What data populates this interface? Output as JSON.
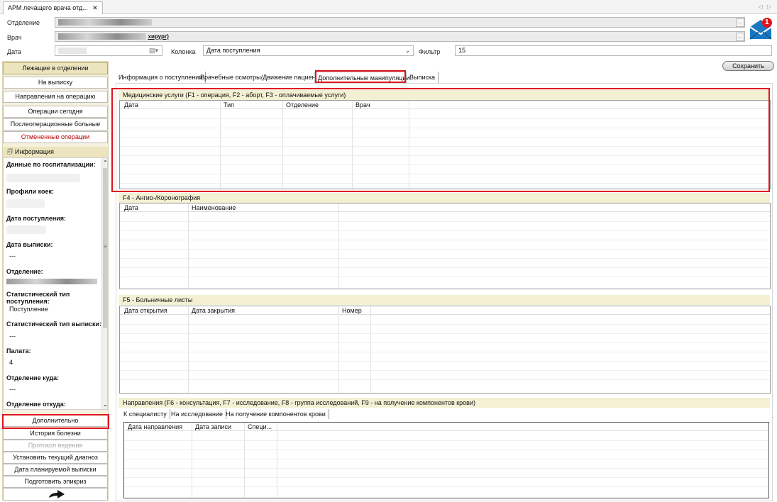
{
  "window": {
    "tab_title": "АРМ лечащего врача отд...",
    "close_glyph": "✕",
    "nav_arrows": "◁ ▷"
  },
  "header": {
    "department_label": "Отделение",
    "doctor_label": "Врач",
    "doctor_value_visible": "хирург)",
    "date_label": "Дата",
    "column_label": "Колонка",
    "column_value": "Дата поступления",
    "filter_label": "Фильтр",
    "filter_value": "15",
    "mail_badge_count": "1"
  },
  "sidebar": {
    "buttons": [
      {
        "label": "Лежащие в отделении",
        "state": "active"
      },
      {
        "label": "На выписку",
        "state": "normal"
      },
      {
        "label": "Направления на операцию",
        "state": "normal"
      },
      {
        "label": "Операции сегодня",
        "state": "normal"
      },
      {
        "label": "Послеоперационные больные",
        "state": "normal"
      },
      {
        "label": "Отмененные операции",
        "state": "red"
      }
    ],
    "info_header": "Информация",
    "info_fields": [
      {
        "title": "Данные по госпитализации:",
        "value": ""
      },
      {
        "title": "Профили коек:",
        "value": ""
      },
      {
        "title": "Дата поступления:",
        "value": ""
      },
      {
        "title": "Дата выписки:",
        "value": "---"
      },
      {
        "title": "Отделение:",
        "value": ""
      },
      {
        "title": "Статистический тип поступления:",
        "value": "Поступление"
      },
      {
        "title": "Статистический тип выписки:",
        "value": "---"
      },
      {
        "title": "Палата:",
        "value": "4"
      },
      {
        "title": "Отделение куда:",
        "value": "---"
      },
      {
        "title": "Отделение откуда:",
        "value": ""
      }
    ],
    "bottom_buttons": [
      {
        "label": "Дополнительно",
        "state": "normal"
      },
      {
        "label": "История болезни",
        "state": "normal"
      },
      {
        "label": "Протокол ведения",
        "state": "disabled"
      },
      {
        "label": "Установить текущий диагноз",
        "state": "normal"
      },
      {
        "label": "Дата планируемой выписки",
        "state": "normal"
      },
      {
        "label": "Подготовить эпикриз",
        "state": "normal"
      }
    ]
  },
  "main": {
    "save_label": "Сохранить",
    "tabs": [
      "Информация о поступлении",
      "Врачебные осмотры/Движение пациента",
      "Дополнительные манипуляции",
      "Выписка"
    ],
    "selected_tab": "Дополнительные манипуляции",
    "sections": {
      "services": {
        "title": "Медицинские услуги (F1 - операция, F2 - аборт, F3 - оплачиваемые услуги)",
        "columns": [
          "Дата",
          "Тип",
          "Отделение",
          "Врач"
        ]
      },
      "angio": {
        "title": "F4 - Ангио-/Коронография",
        "columns": [
          "Дата",
          "Наименование"
        ]
      },
      "sick": {
        "title": "F5 - Больничные листы",
        "columns": [
          "Дата открытия",
          "Дата закрытия",
          "Номер"
        ]
      },
      "referrals": {
        "title": "Направления (F6 - консультация, F7 - исследование, F8 - группа исследований, F9 - на получение компонентов крови)",
        "subtabs": [
          "К специалисту",
          "На исследование",
          "На получение компонентов крови"
        ],
        "columns": [
          "Дата направления",
          "Дата записи",
          "Специ..."
        ]
      }
    }
  },
  "colors": {
    "highlight": "#e0141e",
    "sidebar_bg": "#f5f1dc",
    "active_button": "#ece4bf",
    "section_header": "#f4f0d4"
  }
}
